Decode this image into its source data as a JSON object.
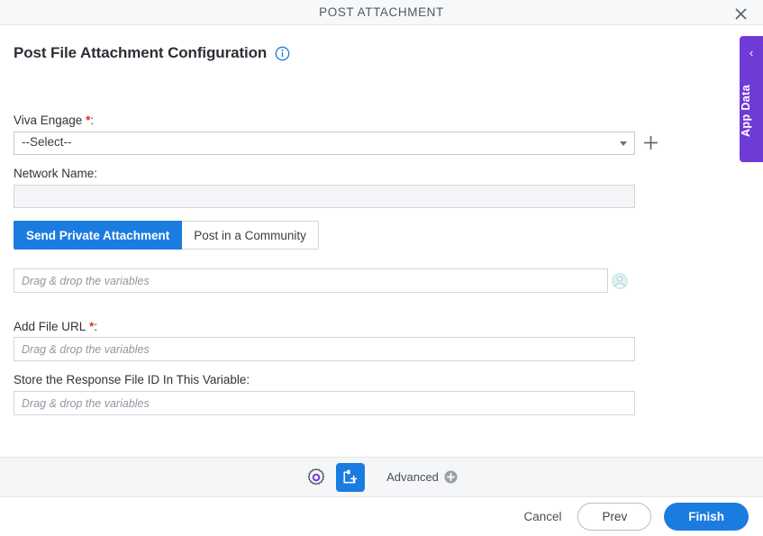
{
  "window": {
    "title": "POST ATTACHMENT",
    "close_icon": "close-icon"
  },
  "page": {
    "heading": "Post File Attachment Configuration",
    "info_icon": "info-icon"
  },
  "fields": {
    "viva_engage": {
      "label": "Viva Engage",
      "required_marker": "*",
      "colon": ":",
      "selected_value": "--Select--",
      "caret_icon": "chevron-down-icon",
      "add_icon": "plus-icon"
    },
    "network_name": {
      "label": "Network Name",
      "colon": ":",
      "value": "",
      "placeholder": ""
    },
    "recipient": {
      "placeholder": "Drag & drop the variables",
      "value": "",
      "picker_icon": "person-icon"
    },
    "add_file_url": {
      "label": "Add File URL",
      "required_marker": "*",
      "colon": ":",
      "placeholder": "Drag & drop the variables",
      "value": ""
    },
    "store_response": {
      "label": "Store the Response File ID In This Variable",
      "colon": ":",
      "placeholder": "Drag & drop the variables",
      "value": ""
    }
  },
  "tabs": [
    {
      "label": "Send Private Attachment",
      "active": true
    },
    {
      "label": "Post in a Community",
      "active": false
    }
  ],
  "side_panel": {
    "label": "App Data",
    "chevron": "‹",
    "chevron_icon": "chevron-left-icon",
    "color": "#6f3bd6"
  },
  "toolbar": {
    "gear_icon": "gear-icon",
    "add_form_icon": "add-form-icon",
    "advanced_label": "Advanced",
    "advanced_add_icon": "plus-circle-icon"
  },
  "footer": {
    "cancel_label": "Cancel",
    "prev_label": "Prev",
    "finish_label": "Finish"
  },
  "colors": {
    "accent_blue": "#1b7ce0",
    "purple": "#6f3bd6",
    "required_red": "#d0342c",
    "gear_purple": "#6f3bd6"
  }
}
